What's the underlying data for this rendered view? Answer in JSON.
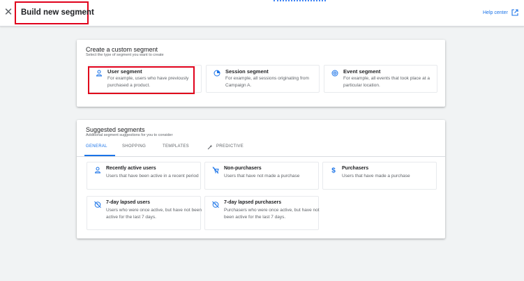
{
  "header": {
    "title": "Build new segment",
    "help_label": "Help center",
    "close_icon": "close-icon",
    "help_icon": "open-in-new-icon"
  },
  "custom_segment": {
    "title": "Create a custom segment",
    "subtitle": "Select the type of segment you want to create",
    "options": [
      {
        "icon": "person-icon",
        "title": "User segment",
        "description": "For example, users who have previously purchased a product."
      },
      {
        "icon": "session-icon",
        "title": "Session segment",
        "description": "For example, all sessions originating from Campaign A."
      },
      {
        "icon": "event-icon",
        "title": "Event segment",
        "description": "For example, all events that took place at a particular location."
      }
    ]
  },
  "suggested": {
    "title": "Suggested segments",
    "subtitle": "Additional segment suggestions for you to consider",
    "tabs": [
      "GENERAL",
      "SHOPPING",
      "TEMPLATES",
      "PREDICTIVE"
    ],
    "active_tab": "GENERAL",
    "items": [
      {
        "icon": "person-icon",
        "title": "Recently active users",
        "description": "Users that have been active in a recent period"
      },
      {
        "icon": "no-cart-icon",
        "title": "Non-purchasers",
        "description": "Users that have not made a purchase"
      },
      {
        "icon": "dollar-icon",
        "title": "Purchasers",
        "description": "Users that have made a purchase"
      },
      {
        "icon": "lapsed-timer-icon",
        "title": "7-day lapsed users",
        "description": "Users who were once active, but have not been active for the last 7 days."
      },
      {
        "icon": "lapsed-timer-icon",
        "title": "7-day lapsed purchasers",
        "description": "Purchasers who were once active, but have not been active for the last 7 days."
      }
    ]
  },
  "colors": {
    "accent": "#1a73e8",
    "highlight": "#e0001b"
  }
}
